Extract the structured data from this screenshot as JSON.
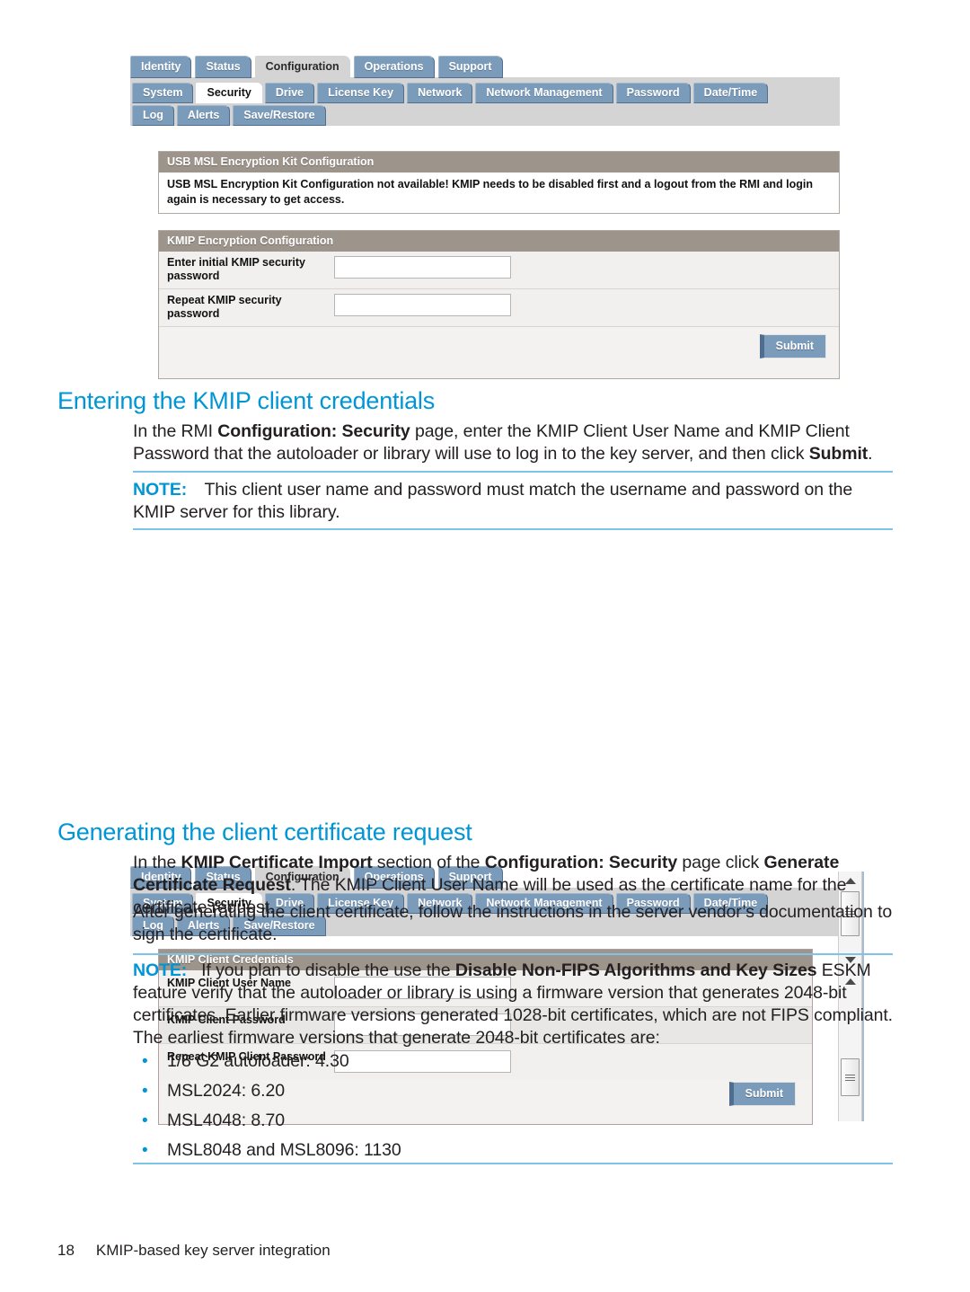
{
  "page": {
    "footer_number": "18",
    "footer_title": "KMIP-based key server integration"
  },
  "colors": {
    "heading_blue": "#0096d6",
    "tab_blue": "#7b9bbb",
    "panel_header_taupe": "#9d948c",
    "rule_blue": "#7ec4e8"
  },
  "screenshot1": {
    "primary_tabs": [
      {
        "label": "Identity",
        "active": false
      },
      {
        "label": "Status",
        "active": false
      },
      {
        "label": "Configuration",
        "active": true
      },
      {
        "label": "Operations",
        "active": false
      },
      {
        "label": "Support",
        "active": false
      }
    ],
    "sub_tabs_row1": [
      {
        "label": "System",
        "active": false
      },
      {
        "label": "Security",
        "active": true
      },
      {
        "label": "Drive",
        "active": false
      },
      {
        "label": "License Key",
        "active": false
      },
      {
        "label": "Network",
        "active": false
      },
      {
        "label": "Network Management",
        "active": false
      },
      {
        "label": "Password",
        "active": false
      },
      {
        "label": "Date/Time",
        "active": false
      }
    ],
    "sub_tabs_row2": [
      {
        "label": "Log",
        "active": false
      },
      {
        "label": "Alerts",
        "active": false
      },
      {
        "label": "Save/Restore",
        "active": false
      }
    ],
    "usb_panel": {
      "title": "USB MSL Encryption Kit Configuration",
      "message": "USB MSL Encryption Kit Configuration not available! KMIP needs to be disabled first and a logout from the RMI and login again is necessary to get access."
    },
    "kmip_panel": {
      "title": "KMIP Encryption Configuration",
      "fields": [
        {
          "label": "Enter initial KMIP security password",
          "value": ""
        },
        {
          "label": "Repeat KMIP security password",
          "value": ""
        }
      ],
      "submit_label": "Submit"
    }
  },
  "section1": {
    "heading": "Entering the KMIP client credentials",
    "paragraph": [
      {
        "t": "In the RMI ",
        "b": false
      },
      {
        "t": "Configuration: Security",
        "b": true
      },
      {
        "t": " page, enter the KMIP Client User Name and KMIP Client Password that the autoloader or library will use to log in to the key server, and then click ",
        "b": false
      },
      {
        "t": "Submit",
        "b": true
      },
      {
        "t": ".",
        "b": false
      }
    ],
    "note_label": "NOTE:",
    "note_text": "This client user name and password must match the username and password on the KMIP server for this library."
  },
  "screenshot2": {
    "primary_tabs": [
      {
        "label": "Identity",
        "active": false
      },
      {
        "label": "Status",
        "active": false
      },
      {
        "label": "Configuration",
        "active": true
      },
      {
        "label": "Operations",
        "active": false
      },
      {
        "label": "Support",
        "active": false
      }
    ],
    "sub_tabs_row1": [
      {
        "label": "System",
        "active": false
      },
      {
        "label": "Security",
        "active": true
      },
      {
        "label": "Drive",
        "active": false
      },
      {
        "label": "License Key",
        "active": false
      },
      {
        "label": "Network",
        "active": false
      },
      {
        "label": "Network Management",
        "active": false
      },
      {
        "label": "Password",
        "active": false
      },
      {
        "label": "Date/Time",
        "active": false
      }
    ],
    "sub_tabs_row2": [
      {
        "label": "Log",
        "active": false
      },
      {
        "label": "Alerts",
        "active": false
      },
      {
        "label": "Save/Restore",
        "active": false
      }
    ],
    "credentials_panel": {
      "title": "KMIP Client Credentials",
      "fields": [
        {
          "label": "KMIP Client User Name",
          "value": ""
        },
        {
          "label": "KMIP Client Password",
          "value": ""
        },
        {
          "label": "Repeat KMIP Client Password",
          "value": ""
        }
      ],
      "submit_label": "Submit"
    }
  },
  "section2": {
    "heading": "Generating the client certificate request",
    "paragraph1": [
      {
        "t": "In the ",
        "b": false
      },
      {
        "t": "KMIP Certificate Import",
        "b": true
      },
      {
        "t": " section of the ",
        "b": false
      },
      {
        "t": "Configuration: Security",
        "b": true
      },
      {
        "t": " page click ",
        "b": false
      },
      {
        "t": "Generate Certificate Request",
        "b": true
      },
      {
        "t": ". The KMIP Client User Name will be used as the certificate name for the certificate request.",
        "b": false
      }
    ],
    "paragraph2": [
      {
        "t": "After generating the client certificate, follow the instructions in the server vendor’s documentation to sign the certificate.",
        "b": false
      }
    ],
    "note_label": "NOTE:",
    "note_text": [
      {
        "t": "If you plan to disable the use the ",
        "b": false
      },
      {
        "t": "Disable Non-FIPS Algorithms and Key Sizes",
        "b": true
      },
      {
        "t": " ESKM feature verify that the autoloader or library is using a firmware version that generates 2048-bit certificates. Earlier firmware versions generated 1028-bit certificates, which are not FIPS compliant. The earliest firmware versions that generate 2048-bit certificates are:",
        "b": false
      }
    ],
    "bullets": [
      "1/8 G2 autoloader: 4.30",
      "MSL2024: 6.20",
      "MSL4048: 8.70",
      "MSL8048 and MSL8096: 1130"
    ]
  }
}
